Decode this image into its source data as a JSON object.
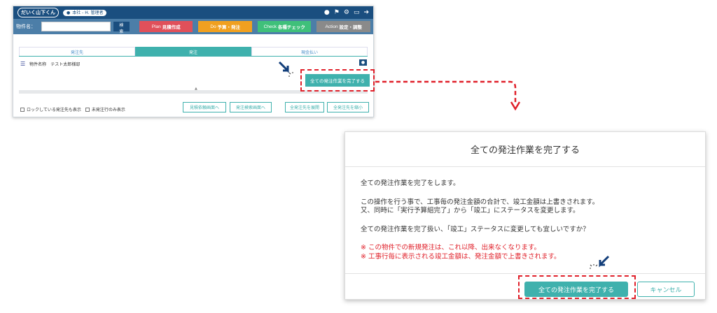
{
  "app": {
    "logo": "だいく山下くん",
    "user_badge": "本社 - H. 管理者",
    "search_label": "物件名：",
    "search_value": "",
    "search_button": "検索",
    "phases": [
      {
        "prefix": "Plan",
        "label": "見積作成"
      },
      {
        "prefix": "Do",
        "label": "予算・発注"
      },
      {
        "prefix": "Check",
        "label": "各種チェック"
      },
      {
        "prefix": "Action",
        "label": "設定・調整"
      }
    ],
    "tabs": [
      "発注先",
      "発注",
      "現金払い"
    ],
    "project_label": "物件名称",
    "project_value": "テスト太郎様邸",
    "complete_all_button": "全ての発注作業を完了する",
    "estimate_screen_button": "見積依頼画面へ",
    "order_search_button": "発注検索画面へ",
    "expand_all_button": "全発注先を展開",
    "collapse_all_button": "全発注先を縮小",
    "show_locked_label": "ロックしている発注先も表示",
    "unordered_only_label": "未発注行のみ表示"
  },
  "dialog": {
    "title": "全ての発注作業を完了する",
    "line1": "全ての発注作業を完了をします。",
    "line2a": "この操作を行う事で、工事毎の発注金額の合計で、竣工金額は上書きされます。",
    "line2b": "又、同時に「実行予算組完了」から「竣工」にステータスを変更します。",
    "line3": "全ての発注作業を完了扱い、「竣工」ステータスに変更しても宜しいですか？",
    "warn1": "※ この物件での新規発注は、これ以降、出来なくなります。",
    "warn2": "※ 工事行毎に表示される竣工金額は、発注金額で上書きされます。",
    "confirm_button": "全ての発注作業を完了する",
    "cancel_button": "キャンセル"
  },
  "colors": {
    "header": "#1a4e7f",
    "toolbar": "#4c7ea8",
    "teal": "#3fb1ad",
    "highlight": "#e0202a"
  }
}
